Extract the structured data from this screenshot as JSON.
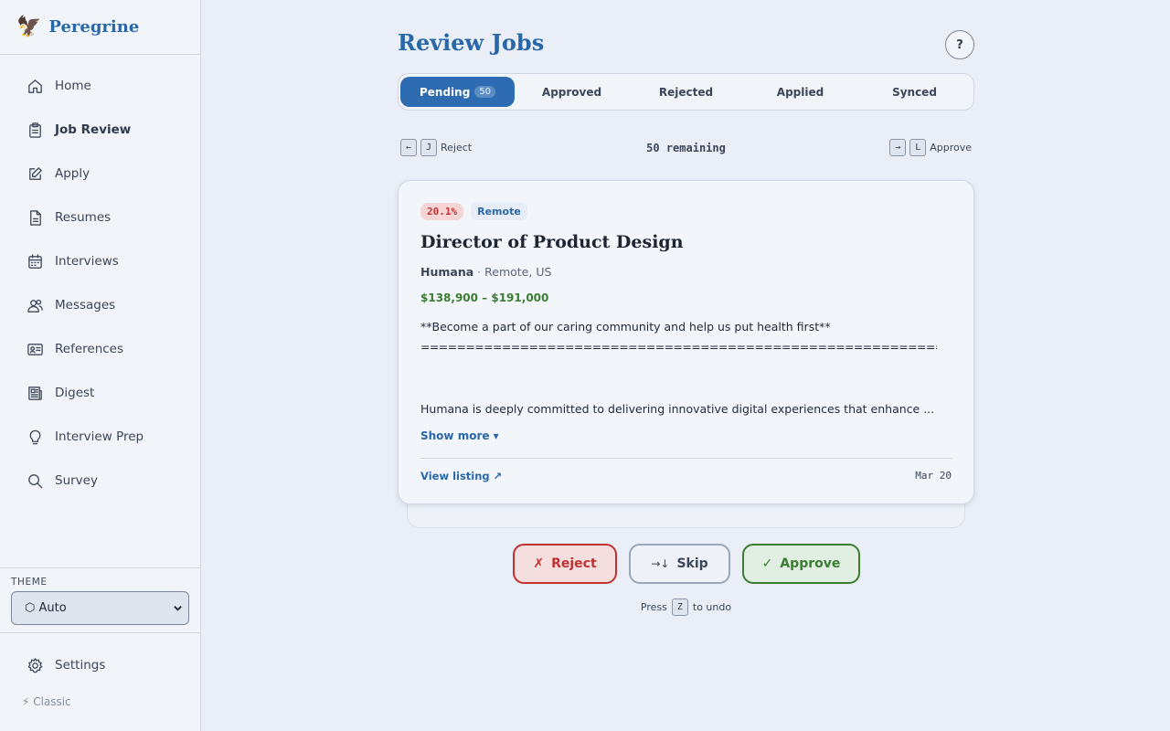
{
  "brand": {
    "logo": "🦅",
    "name": "Peregrine"
  },
  "nav": [
    {
      "label": "Home",
      "icon": "home-icon",
      "active": false
    },
    {
      "label": "Job Review",
      "icon": "clipboard-icon",
      "active": true
    },
    {
      "label": "Apply",
      "icon": "pencil-square-icon",
      "active": false
    },
    {
      "label": "Resumes",
      "icon": "document-icon",
      "active": false
    },
    {
      "label": "Interviews",
      "icon": "calendar-icon",
      "active": false
    },
    {
      "label": "Messages",
      "icon": "users-icon",
      "active": false
    },
    {
      "label": "References",
      "icon": "id-card-icon",
      "active": false
    },
    {
      "label": "Digest",
      "icon": "newspaper-icon",
      "active": false
    },
    {
      "label": "Interview Prep",
      "icon": "lightbulb-icon",
      "active": false
    },
    {
      "label": "Survey",
      "icon": "search-icon",
      "active": false
    }
  ],
  "theme": {
    "label": "THEME",
    "selected": "⬡ Auto"
  },
  "settings": {
    "label": "Settings"
  },
  "classic": {
    "label": "⚡ Classic"
  },
  "page": {
    "title": "Review Jobs",
    "help_label": "?"
  },
  "tabs": [
    {
      "label": "Pending",
      "count": "50",
      "active": true
    },
    {
      "label": "Approved",
      "count": null,
      "active": false
    },
    {
      "label": "Rejected",
      "count": null,
      "active": false
    },
    {
      "label": "Applied",
      "count": null,
      "active": false
    },
    {
      "label": "Synced",
      "count": null,
      "active": false
    }
  ],
  "hints": {
    "left_arrow": "←",
    "left_key": "J",
    "left_label": "Reject",
    "remaining": "50 remaining",
    "right_arrow": "→",
    "right_key": "L",
    "right_label": "Approve"
  },
  "job": {
    "match_score": "20.1%",
    "remote_badge": "Remote",
    "title": "Director of Product Design",
    "company": "Humana",
    "location": "Remote, US",
    "salary": "$138,900 – $191,000",
    "desc_line1": "**Become a part of our caring community and help us put health first**",
    "desc_rule": "=======================================================================",
    "desc_line2": "Humana is deeply committed to delivering innovative digital experiences that enhance ...",
    "show_more": "Show more ▾",
    "view_listing": "View listing ↗",
    "posted": "Mar 20"
  },
  "actions": {
    "reject_symbol": "✗",
    "reject_label": "Reject",
    "skip_symbol": "→↓",
    "skip_label": "Skip",
    "approve_symbol": "✓",
    "approve_label": "Approve"
  },
  "undo": {
    "prefix": "Press",
    "key": "Z",
    "suffix": "to undo"
  },
  "colors": {
    "accent": "#2a67a8",
    "reject": "#c03232",
    "approve": "#3a7d32",
    "background": "#e9eef7"
  }
}
